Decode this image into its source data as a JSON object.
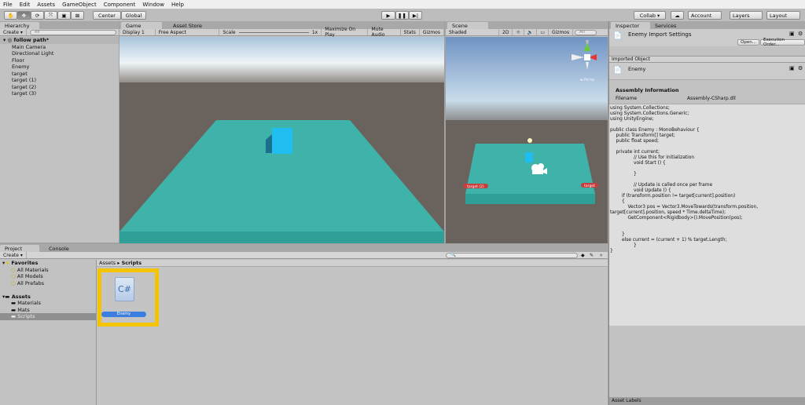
{
  "menu": [
    "File",
    "Edit",
    "Assets",
    "GameObject",
    "Component",
    "Window",
    "Help"
  ],
  "toolbar": {
    "tools": [
      "hand-tool",
      "move-tool",
      "rotate-tool",
      "scale-tool",
      "rect-tool",
      "transform-tool"
    ],
    "pivot": "Center",
    "space": "Global",
    "collab": "Collab ▾",
    "account": "Account",
    "layers": "Layers",
    "layout": "Layout"
  },
  "hierarchy": {
    "tab": "Hierarchy",
    "create": "Create ▾",
    "search_placeholder": "All",
    "scene": "follow path*",
    "items": [
      "Main Camera",
      "Directional Light",
      "Floor",
      "Enemy",
      "target",
      "target (1)",
      "target (2)",
      "target (3)"
    ]
  },
  "game": {
    "tab": "Game",
    "tab2": "Asset Store",
    "display": "Display 1",
    "aspect": "Free Aspect",
    "scale_label": "Scale",
    "scale_value": "1x",
    "maximize": "Maximize On Play",
    "mute": "Mute Audio",
    "stats": "Stats",
    "gizmos": "Gizmos"
  },
  "scene": {
    "tab": "Scene",
    "shading": "Shaded",
    "mode2d": "2D",
    "gizmos": "Gizmos",
    "search_placeholder": "All",
    "labels": [
      "target (2)",
      "target"
    ],
    "persp": "◄ Persp"
  },
  "inspector": {
    "tab": "Inspector",
    "tab2": "Services",
    "title": "Enemy Import Settings",
    "open": "Open...",
    "exec": "Execution Order...",
    "imported": "Imported Object",
    "object": "Enemy",
    "assembly_header": "Assembly Information",
    "filename_label": "Filename",
    "filename": "Assembly-CSharp.dll",
    "code": "using System.Collections;\nusing System.Collections.Generic;\nusing UnityEngine;\n\npublic class Enemy : MonoBehaviour {\n    public Transform[] target;\n    public float speed;\n\n    private int current;\n                // Use this for initialization\n                void Start () {\n\n                }\n\n                // Update is called once per frame\n                void Update () {\n        if (transform.position != target[current].position)\n        {\n            Vector3 pos = Vector3.MoveTowards(transform.position,\ntarget[current].position, speed * Time.deltaTime);\n            GetComponent<Rigidbody>().MovePosition(pos);\n\n\n        }\n        else current = (current + 1) % target.Length;\n                }\n}",
    "asset_labels": "Asset Labels"
  },
  "project": {
    "tab": "Project",
    "tab2": "Console",
    "create": "Create ▾",
    "favorites": "Favorites",
    "fav_items": [
      "All Materials",
      "All Models",
      "All Prefabs"
    ],
    "assets": "Assets",
    "asset_items": [
      "Materials",
      "Mats",
      "Scripts"
    ],
    "breadcrumb": [
      "Assets",
      "Scripts"
    ],
    "file": "Enemy",
    "highlight": "#f5c400"
  }
}
